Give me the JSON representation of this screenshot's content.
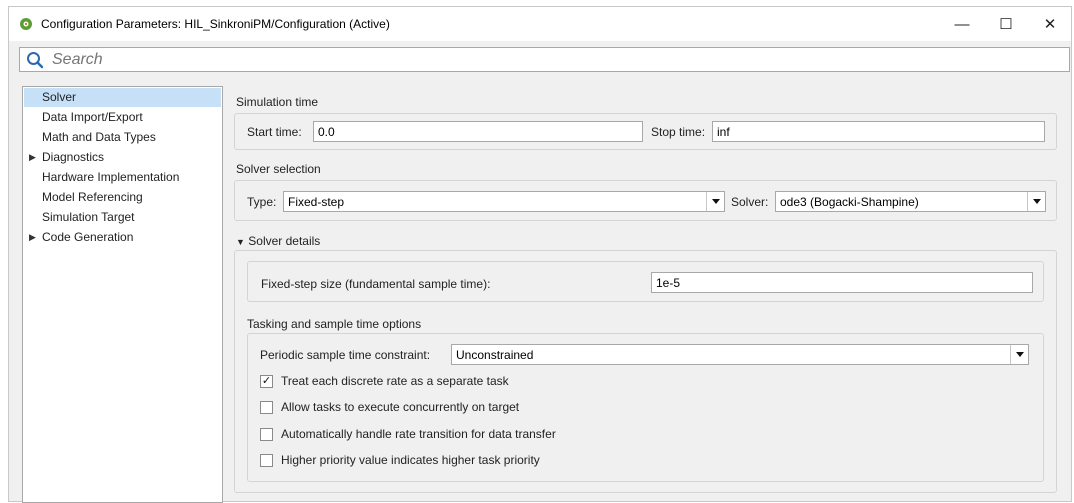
{
  "window": {
    "title": "Configuration Parameters: HIL_SinkroniPM/Configuration (Active)",
    "controls": {
      "minimize": "—",
      "maximize": "☐",
      "close": "✕"
    }
  },
  "search": {
    "placeholder": "Search",
    "value": ""
  },
  "tree": {
    "items": [
      {
        "label": "Solver",
        "selected": true,
        "expandable": false
      },
      {
        "label": "Data Import/Export",
        "selected": false,
        "expandable": false
      },
      {
        "label": "Math and Data Types",
        "selected": false,
        "expandable": false
      },
      {
        "label": "Diagnostics",
        "selected": false,
        "expandable": true
      },
      {
        "label": "Hardware Implementation",
        "selected": false,
        "expandable": false
      },
      {
        "label": "Model Referencing",
        "selected": false,
        "expandable": false
      },
      {
        "label": "Simulation Target",
        "selected": false,
        "expandable": false
      },
      {
        "label": "Code Generation",
        "selected": false,
        "expandable": true
      }
    ],
    "arrow": "▶"
  },
  "simulation_time": {
    "title": "Simulation time",
    "start_label": "Start time:",
    "start_value": "0.0",
    "stop_label": "Stop time:",
    "stop_value": "inf"
  },
  "solver_selection": {
    "title": "Solver selection",
    "type_label": "Type:",
    "type_value": "Fixed-step",
    "solver_label": "Solver:",
    "solver_value": "ode3 (Bogacki-Shampine)"
  },
  "solver_details": {
    "title": "Solver details",
    "arrow": "▼",
    "step_size_label": "Fixed-step size (fundamental sample time):",
    "step_size_value": "1e-5"
  },
  "tasking": {
    "title": "Tasking and sample time options",
    "periodic_label": "Periodic sample time constraint:",
    "periodic_value": "Unconstrained",
    "checkboxes": [
      {
        "label": "Treat each discrete rate as a separate task",
        "checked": true
      },
      {
        "label": "Allow tasks to execute concurrently on target",
        "checked": false
      },
      {
        "label": "Automatically handle rate transition for data transfer",
        "checked": false
      },
      {
        "label": "Higher priority value indicates higher task priority",
        "checked": false
      }
    ],
    "check_glyph": "✓"
  },
  "colors": {
    "selection": "#c6e0f8",
    "panel": "#f0f0f0",
    "border": "#a8a8a8",
    "app_icon": "#5a9e3a"
  }
}
